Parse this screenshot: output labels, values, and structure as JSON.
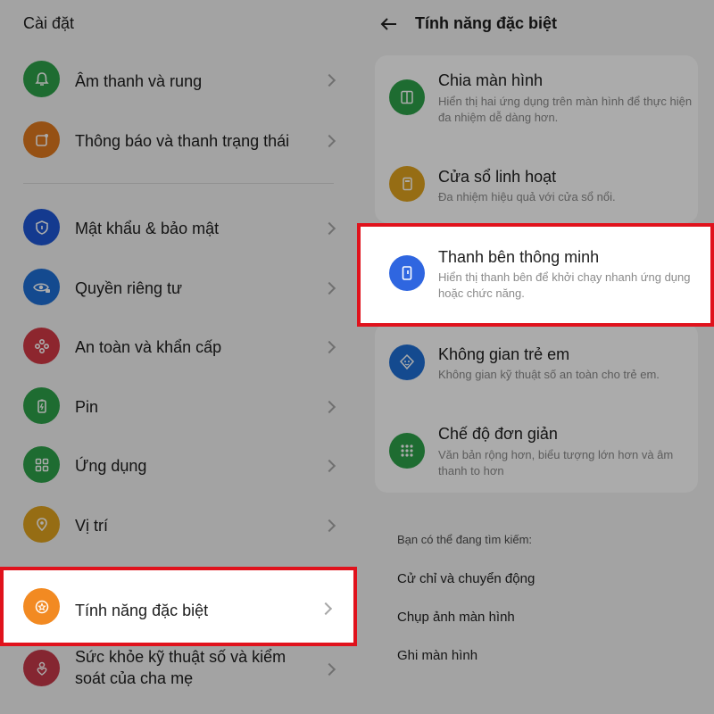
{
  "left": {
    "title": "Cài đặt",
    "items": [
      {
        "label": "Âm thanh và rung",
        "icon": "bell-icon",
        "color": "#2ea24a"
      },
      {
        "label": "Thông báo và thanh trạng thái",
        "icon": "notification-icon",
        "color": "#e07a1e"
      },
      {
        "label": "Mật khẩu & bảo mật",
        "icon": "shield-icon",
        "color": "#1e57d6"
      },
      {
        "label": "Quyền riêng tư",
        "icon": "eye-lock-icon",
        "color": "#1e6fd6"
      },
      {
        "label": "An toàn và khẩn cấp",
        "icon": "asterisk-icon",
        "color": "#d23a45"
      },
      {
        "label": "Pin",
        "icon": "battery-icon",
        "color": "#2ea24a"
      },
      {
        "label": "Ứng dụng",
        "icon": "apps-grid-icon",
        "color": "#2ea24a"
      },
      {
        "label": "Vị trí",
        "icon": "location-pin-icon",
        "color": "#e0a31e"
      },
      {
        "label": "Tính năng đặc biệt",
        "icon": "star-badge-icon",
        "color": "#f28a22"
      },
      {
        "label_line1": "Sức khỏe kỹ thuật số và kiểm",
        "label_line2": "soát của cha mẹ",
        "icon": "heart-person-icon",
        "color": "#c63a4a"
      }
    ]
  },
  "right": {
    "back_icon": "arrow-left-icon",
    "title": "Tính năng đặc biệt",
    "features": [
      {
        "title": "Chia màn hình",
        "desc": "Hiển thị hai ứng dụng trên màn hình để thực hiện đa nhiệm dễ dàng hơn.",
        "icon": "split-screen-icon",
        "color": "#2ea24a"
      },
      {
        "title": "Cửa sổ linh hoạt",
        "desc": "Đa nhiệm hiệu quả với cửa sổ nổi.",
        "icon": "floating-window-icon",
        "color": "#e0a31e"
      },
      {
        "title": "Thanh bên thông minh",
        "desc": "Hiển thị thanh bên để khởi chạy nhanh ứng dụng hoặc chức năng.",
        "icon": "sidebar-icon",
        "color": "#2f66e0"
      },
      {
        "title": "Không gian trẻ em",
        "desc": "Không gian kỹ thuật số an toàn cho trẻ em.",
        "icon": "kid-face-icon",
        "color": "#1e6fd6"
      },
      {
        "title": "Chế độ đơn giản",
        "desc": "Văn bản rộng hơn, biểu tượng lớn hơn và âm thanh to hơn",
        "icon": "grid-dots-icon",
        "color": "#2ea24a"
      }
    ],
    "search_heading": "Bạn có thể đang tìm kiếm:",
    "suggestions": [
      "Cử chỉ và chuyển động",
      "Chụp ảnh màn hình",
      "Ghi màn hình"
    ]
  },
  "colors": {
    "highlight_border": "#e0121c",
    "overlay": "rgba(0,0,0,0.33)"
  }
}
